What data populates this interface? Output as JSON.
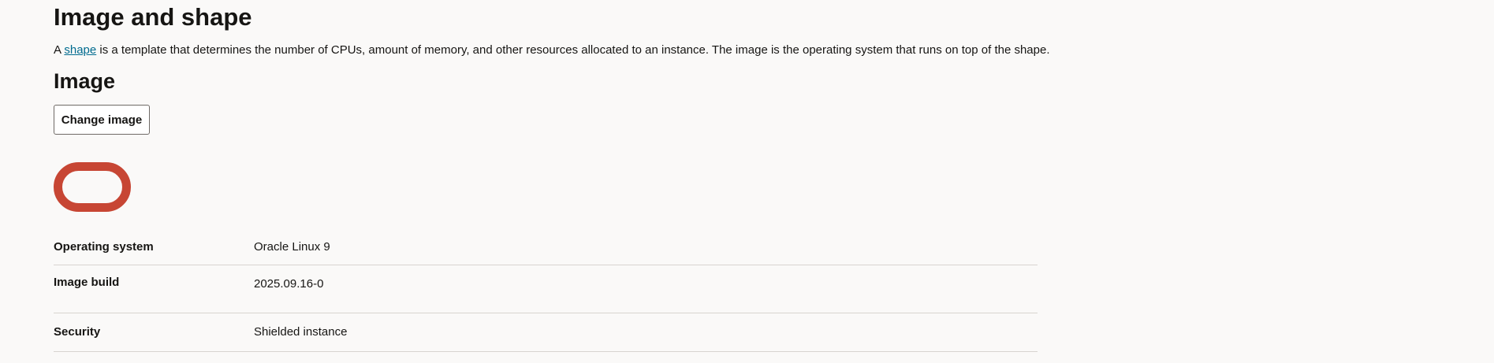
{
  "header": {
    "title": "Image and shape",
    "description_prefix": "A ",
    "description_link": "shape",
    "description_suffix": " is a template that determines the number of CPUs, amount of memory, and other resources allocated to an instance. The image is the operating system that runs on top of the shape."
  },
  "image_section": {
    "title": "Image",
    "change_button_label": "Change image",
    "logo_icon": "oracle-logo-icon",
    "logo_color": "#c74634"
  },
  "details": [
    {
      "label": "Operating system",
      "value": "Oracle Linux 9"
    },
    {
      "label": "Image build",
      "value": "2025.09.16-0"
    },
    {
      "label": "Security",
      "value": "Shielded instance"
    }
  ]
}
